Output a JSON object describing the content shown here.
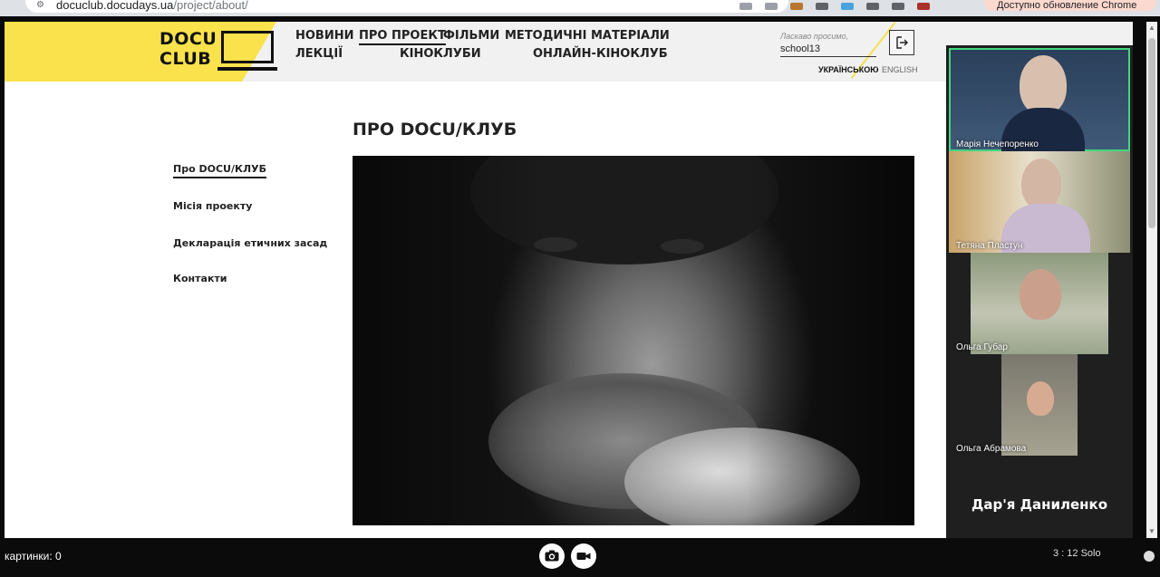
{
  "browser": {
    "url_domain": "docuclub.docudays.ua",
    "url_path": "/project/about/",
    "update_button": "Доступно обновление Chrome"
  },
  "site": {
    "logo_line1": "DOCU",
    "logo_line2": "CLUB",
    "nav": {
      "news": "НОВИНИ",
      "project": "ПРО ПРОЕКТ",
      "films": "ФІЛЬМИ",
      "methods": "МЕТОДИЧНІ МАТЕРІАЛИ",
      "lectures": "ЛЕКЦІЇ",
      "clubs": "КІНОКЛУБИ",
      "online": "ОНЛАЙН-КІНОКЛУБ"
    },
    "welcome": "Ласкаво просимо,",
    "username": "school13",
    "lang_ua": "УКРАЇНСЬКОЮ",
    "lang_sep": "/",
    "lang_en": "ENGLISH",
    "page_title": "ПРО DOCU/КЛУБ",
    "sidenav": [
      "Про DOCU/КЛУБ",
      "Місія проекту",
      "Декларація етичних засад",
      "Контакти"
    ]
  },
  "participants": [
    {
      "name": "Марія Нечепоренко"
    },
    {
      "name": "Тетяна Пластун"
    },
    {
      "name": "Ольга Губар"
    },
    {
      "name": "Ольга Абрамова"
    },
    {
      "name": "Дар'я Даниленко"
    }
  ],
  "colors": {
    "accent_yellow": "#f9e24c",
    "active_speaker": "#43d57f"
  },
  "bottombar": {
    "pictures_label": "картинки: 0",
    "time_text": "3 : 12 Solo"
  }
}
